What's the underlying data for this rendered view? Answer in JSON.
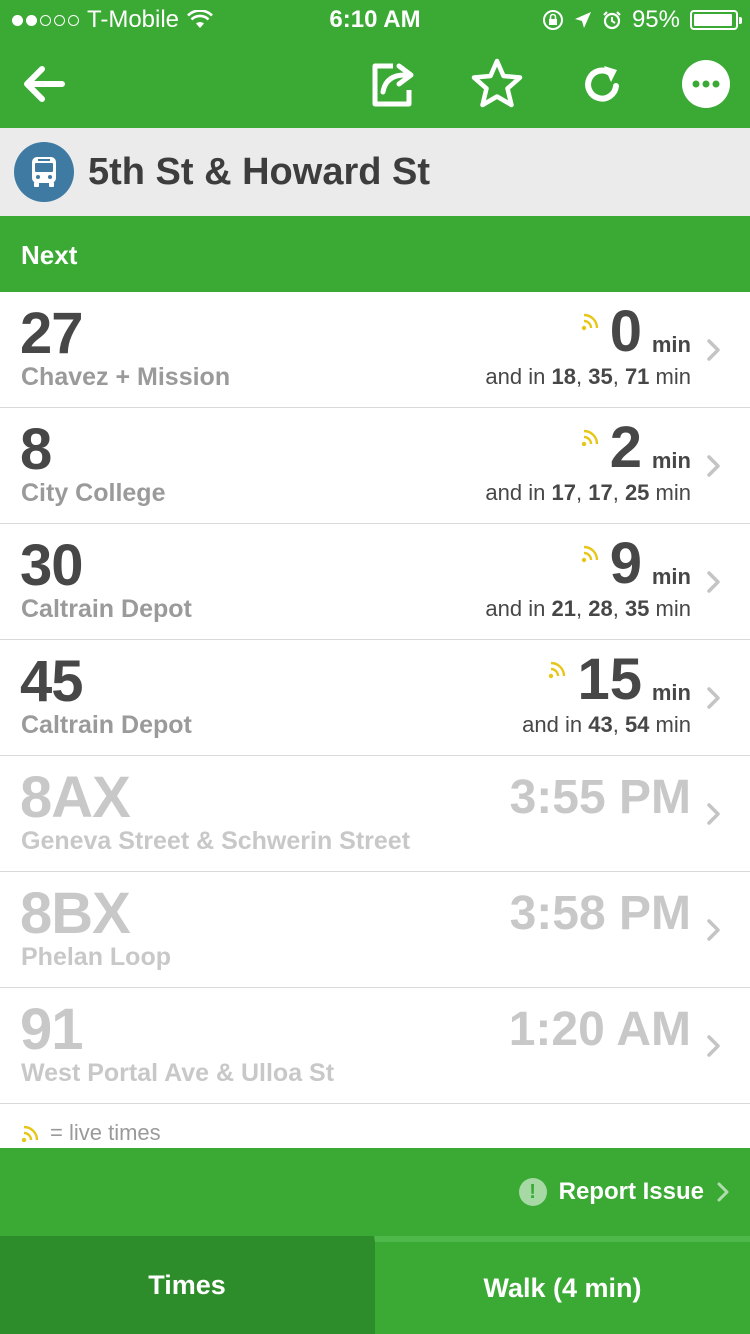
{
  "status_bar": {
    "carrier": "T-Mobile",
    "time": "6:10 AM",
    "battery": "95%",
    "battery_level": 0.95,
    "signal_bars_filled": 2,
    "signal_bars_total": 5
  },
  "nav": {
    "back_icon": "arrow-left-icon",
    "share_icon": "share-icon",
    "favorite_icon": "star-icon",
    "refresh_icon": "refresh-icon",
    "more_icon": "more-icon"
  },
  "stop": {
    "name": "5th St & Howard St",
    "icon": "bus-icon"
  },
  "section": {
    "title": "Next"
  },
  "live_routes": [
    {
      "route": "27",
      "destination": "Chavez + Mission",
      "next": "0",
      "unit": "min",
      "more_prefix": "and in",
      "more_times": [
        "18",
        "35",
        "71"
      ],
      "more_suffix": "min"
    },
    {
      "route": "8",
      "destination": "City College",
      "next": "2",
      "unit": "min",
      "more_prefix": "and in",
      "more_times": [
        "17",
        "17",
        "25"
      ],
      "more_suffix": "min"
    },
    {
      "route": "30",
      "destination": "Caltrain Depot",
      "next": "9",
      "unit": "min",
      "more_prefix": "and in",
      "more_times": [
        "21",
        "28",
        "35"
      ],
      "more_suffix": "min"
    },
    {
      "route": "45",
      "destination": "Caltrain Depot",
      "next": "15",
      "unit": "min",
      "more_prefix": "and in",
      "more_times": [
        "43",
        "54"
      ],
      "more_suffix": "min"
    }
  ],
  "scheduled_routes": [
    {
      "route": "8AX",
      "destination": "Geneva Street & Schwerin Street",
      "time": "3:55 PM"
    },
    {
      "route": "8BX",
      "destination": "Phelan Loop",
      "time": "3:58 PM"
    },
    {
      "route": "91",
      "destination": "West Portal Ave & Ulloa St",
      "time": "1:20 AM"
    }
  ],
  "legend": {
    "text": "= live times"
  },
  "report": {
    "label": "Report Issue",
    "icon": "!"
  },
  "tabs": {
    "times": "Times",
    "walk": "Walk (4 min)"
  },
  "colors": {
    "brand_green": "#3aaa35",
    "tab_active": "#2e8d2b",
    "stop_icon_bg": "#3f7aa3",
    "live_signal": "#e6c619"
  }
}
